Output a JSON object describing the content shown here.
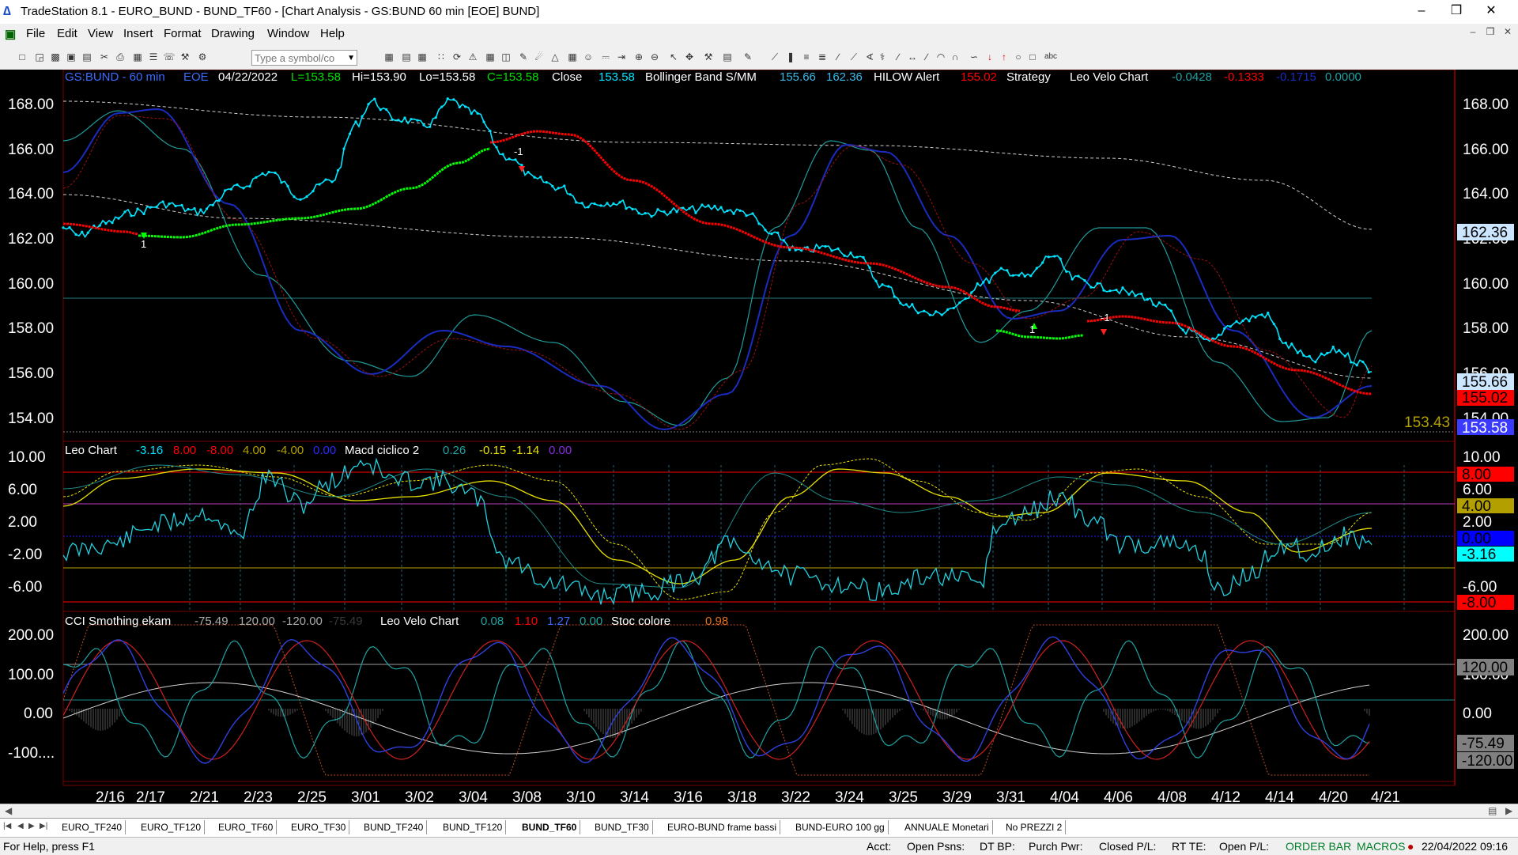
{
  "window": {
    "app_title": "TradeStation 8.1 - EURO_BUND - BUND_TF60 - [Chart Analysis - GS:BUND  60 min  [EOE] BUND]",
    "icon": "tradestation-logo-icon",
    "controls": [
      "–",
      "❒",
      "✕"
    ]
  },
  "menu": {
    "items": [
      "File",
      "Edit",
      "View",
      "Insert",
      "Format",
      "Drawing",
      "Window",
      "Help"
    ],
    "mdi_controls": [
      "–",
      "❒",
      "✕"
    ]
  },
  "toolbar": {
    "symbol_placeholder": "Type a symbol/co"
  },
  "chart": {
    "price_header": {
      "symbol": "GS:BUND - 60 min",
      "session": "EOE",
      "date": "04/22/2022",
      "last": "L=153.58",
      "high": "Hi=153.90",
      "low": "Lo=153.58",
      "close": "C=153.58",
      "close_label": "Close",
      "close_value": "153.58",
      "bb_label": "Bollinger Band S/MM",
      "bb_v1": "155.66",
      "bb_v2": "162.36",
      "hilow_label": "HILOW Alert",
      "hilow_v": "155.02",
      "strategy_label": "Strategy",
      "leovelo_label": "Leo Velo Chart",
      "lv1": "-0.0428",
      "lv2": "-0.1333",
      "lv3": "-0.1715",
      "lv4": "0.0000"
    },
    "leo_header": {
      "label": "Leo Chart",
      "v1": "-3.16",
      "v2": "8.00",
      "v3": "-8.00",
      "v4": "4.00",
      "v5": "-4.00",
      "v6": "0.00",
      "macd_label": "Macd ciclico 2",
      "m1": "0.26",
      "m2": "-0.15",
      "m3": "-1.14",
      "m4": "0.00"
    },
    "cci_header": {
      "label": "CCI Smothing ekam",
      "c1": "-75.49",
      "c2": "120.00",
      "c3": "-120.00",
      "c4": "-75.49",
      "leovelo_label": "Leo Velo Chart",
      "l1": "0.08",
      "l2": "1.10",
      "l3": "1.27",
      "l4": "0.00",
      "stoc_label": "Stoc colore",
      "s1": "0.98"
    },
    "price_axis": [
      "168.00",
      "166.00",
      "164.00",
      "162.00",
      "160.00",
      "158.00",
      "156.00",
      "154.00"
    ],
    "leo_axis": [
      "10.00",
      "6.00",
      "2.00",
      "-2.00",
      "-6.00"
    ],
    "cci_axis": [
      "200.00",
      "100.00",
      "0.00",
      "-100...."
    ],
    "price_tags": [
      {
        "text": "162.36",
        "bg": "#cce6ff",
        "fg": "#000000"
      },
      {
        "text": "155.66",
        "bg": "#cce6ff",
        "fg": "#000000"
      },
      {
        "text": "155.02",
        "bg": "#ff0000",
        "fg": "#000000"
      },
      {
        "text": "153.58",
        "bg": "#3b3bff",
        "fg": "#ffffff"
      }
    ],
    "last_price_label": "153.43",
    "leo_tags": [
      {
        "text": "8.00",
        "bg": "#ff0000",
        "fg": "#000000"
      },
      {
        "text": "4.00",
        "bg": "#b3a000",
        "fg": "#000000"
      },
      {
        "text": "0.00",
        "bg": "#0000ff",
        "fg": "#000000"
      },
      {
        "text": "-3.16",
        "bg": "#00ffff",
        "fg": "#000000"
      },
      {
        "text": "-8.00",
        "bg": "#ff0000",
        "fg": "#000000"
      }
    ],
    "cci_tags": [
      {
        "text": "120.00",
        "bg": "#808080",
        "fg": "#000000"
      },
      {
        "text": "-75.49",
        "bg": "#808080",
        "fg": "#000000"
      },
      {
        "text": "-120.00",
        "bg": "#808080",
        "fg": "#000000"
      }
    ],
    "strategy_labels": [
      "1",
      "-1",
      "1",
      "-1"
    ],
    "dates": [
      "2/16",
      "2/17",
      "2/21",
      "2/23",
      "2/25",
      "3/01",
      "3/02",
      "3/04",
      "3/08",
      "3/10",
      "3/14",
      "3/16",
      "3/18",
      "3/22",
      "3/24",
      "3/25",
      "3/29",
      "3/31",
      "4/04",
      "4/06",
      "4/08",
      "4/12",
      "4/14",
      "4/20",
      "4/21"
    ],
    "colors": {
      "price": "#00e5ff",
      "header_symbol": "#3b6bff",
      "hilow": "#ff0000",
      "strategy_up": "#00ff00",
      "band_blue": "#1a2cc0",
      "band_teal": "#1f9b9b",
      "leo_yellow": "#e8e000"
    }
  },
  "sheet_tabs": [
    "EURO_TF240",
    "EURO_TF120",
    "EURO_TF60",
    "EURO_TF30",
    "BUND_TF240",
    "BUND_TF120",
    "BUND_TF60",
    "BUND_TF30",
    "EURO-BUND frame bassi",
    "BUND-EURO 100 gg",
    "ANNUALE Monetari",
    "No PREZZI 2"
  ],
  "active_tab": "BUND_TF60",
  "status": {
    "help": "For Help, press F1",
    "acct": "Acct:",
    "open_psns": "Open Psns:",
    "dt_bp": "DT BP:",
    "purch_pwr": "Purch Pwr:",
    "closed_pl": "Closed P/L:",
    "rt_te": "RT TE:",
    "open_pl": "Open P/L:",
    "order_bar": "ORDER BAR",
    "macros": "MACROS",
    "datetime": "22/04/2022 09:16"
  }
}
